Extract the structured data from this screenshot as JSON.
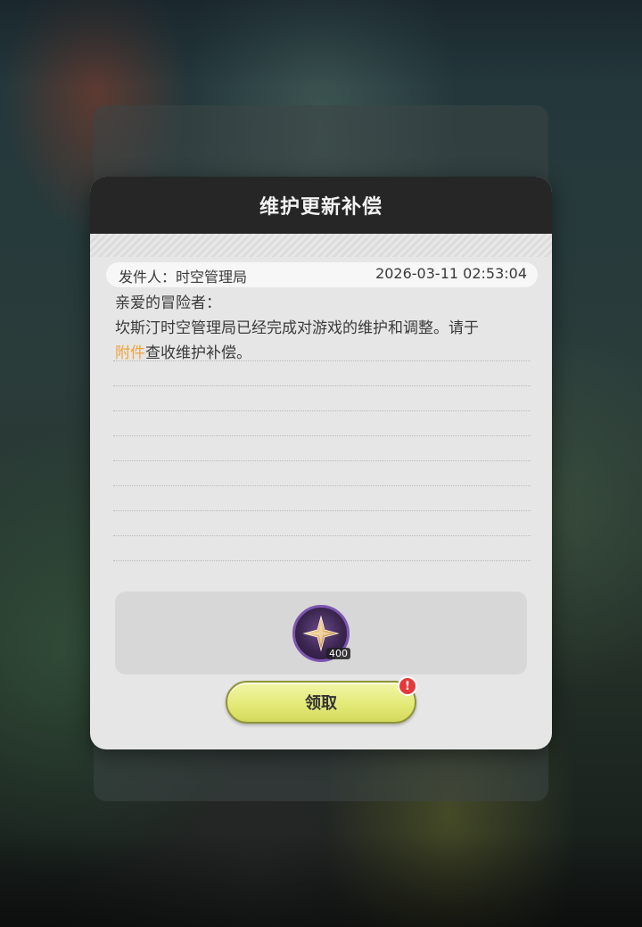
{
  "dialog": {
    "title": "维护更新补偿",
    "sender": "发件人：时空管理局",
    "timestamp": "2026-03-11 02:53:04",
    "greeting": "亲爱的冒险者：",
    "body_line1": "坎斯汀时空管理局已经完成对游戏的维护和调整。请于",
    "body_highlight": "附件",
    "body_line2_rest": "查收维护补偿。",
    "highlight_color": "#f0a23a"
  },
  "attachment": {
    "icon": "star-crystal-icon",
    "count": "400"
  },
  "claim": {
    "label": "领取",
    "badge": "!"
  }
}
